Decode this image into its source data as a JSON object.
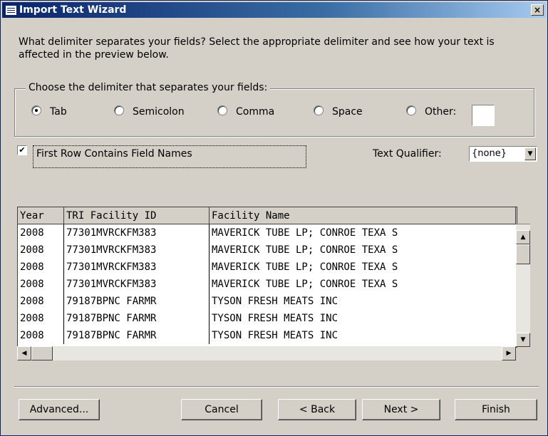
{
  "window": {
    "title": "Import Text Wizard",
    "close_glyph": "×"
  },
  "instructions": "What delimiter separates your fields? Select the appropriate delimiter and see how your text is affected in the preview below.",
  "delimiter_group": {
    "legend": "Choose the delimiter that separates your fields:",
    "options": [
      {
        "label": "Tab",
        "accel": "T",
        "selected": true
      },
      {
        "label": "Semicolon",
        "accel": "S",
        "selected": false
      },
      {
        "label": "Comma",
        "accel": "C",
        "selected": false
      },
      {
        "label": "Space",
        "accel": "p",
        "selected": false
      },
      {
        "label": "Other:",
        "accel": "O",
        "selected": false
      }
    ],
    "other_value": ""
  },
  "first_row": {
    "label": "First Row Contains Field Names",
    "checked": true
  },
  "text_qualifier": {
    "label": "Text Qualifier:",
    "value": "{none}"
  },
  "preview": {
    "headers": [
      "Year",
      "TRI Facility ID",
      "Facility Name"
    ],
    "rows": [
      [
        "2008",
        "77301MVRCKFM383",
        "MAVERICK TUBE LP; CONROE TEXA S"
      ],
      [
        "2008",
        "77301MVRCKFM383",
        "MAVERICK TUBE LP; CONROE TEXA S"
      ],
      [
        "2008",
        "77301MVRCKFM383",
        "MAVERICK TUBE LP; CONROE TEXA S"
      ],
      [
        "2008",
        "77301MVRCKFM383",
        "MAVERICK TUBE LP; CONROE TEXA S"
      ],
      [
        "2008",
        "79187BPNC FARMR",
        "TYSON FRESH MEATS INC"
      ],
      [
        "2008",
        "79187BPNC FARMR",
        "TYSON FRESH MEATS INC"
      ],
      [
        "2008",
        "79187BPNC FARMR",
        "TYSON FRESH MEATS INC"
      ]
    ]
  },
  "buttons": {
    "advanced": "Advanced...",
    "cancel": "Cancel",
    "back": "< Back",
    "next": "Next >",
    "finish": "Finish"
  },
  "icons": {
    "scroll_up": "▲",
    "scroll_down": "▼",
    "scroll_left": "◀",
    "scroll_right": "▶",
    "check": "✔"
  }
}
